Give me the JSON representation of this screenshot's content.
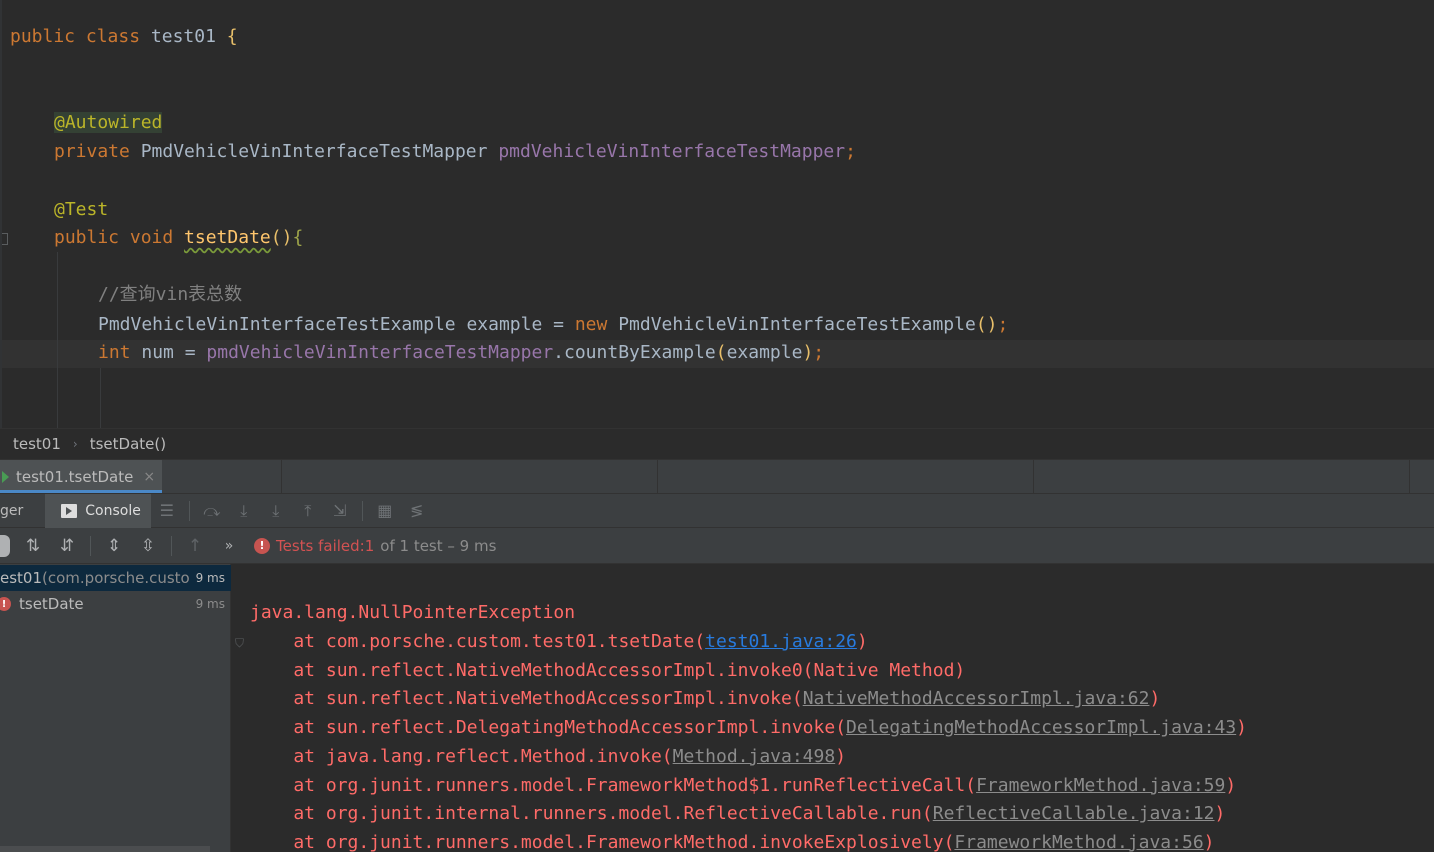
{
  "editor": {
    "lines": {
      "l1": {
        "kw": "public class ",
        "name": "test01 ",
        "brace": "{"
      },
      "l2": {
        "ann": "@Autowired"
      },
      "l3": {
        "kw": "private ",
        "type": "PmdVehicleVinInterfaceTestMapper ",
        "field": "pmdVehicleVinInterfaceTestMapper",
        "semi": ";"
      },
      "l4": {
        "ann": "@Test"
      },
      "l5": {
        "kw": "public void ",
        "fn": "tsetDate",
        "paren": "()",
        "brace": "{"
      },
      "l6": {
        "comment": "//查询vin表总数"
      },
      "l7": {
        "type": "PmdVehicleVinInterfaceTestExample example = ",
        "kw": "new ",
        "ctor": "PmdVehicleVinInterfaceTestExample",
        "paren": "()",
        "semi": ";"
      },
      "l8": {
        "kw": "int ",
        "var": "num = ",
        "field": "pmdVehicleVinInterfaceTestMapper",
        "call": ".countByExample",
        "arg_open": "(",
        "arg": "example",
        "arg_close": ")",
        "semi": ";"
      }
    }
  },
  "breadcrumb": {
    "class": "test01",
    "method": "tsetDate()"
  },
  "run_tab": {
    "label": "test01.tsetDate",
    "close": "×"
  },
  "toolbar": {
    "debugger_label": "ger",
    "console_label": "Console"
  },
  "test_status": {
    "prefix": "Tests failed: ",
    "failed": "1",
    "rest": "of 1 test – 9 ms"
  },
  "test_tree": {
    "root": {
      "name": "est01",
      "pkg": " (com.porsche.custo",
      "time": "9 ms"
    },
    "child": {
      "name": "tsetDate",
      "time": "9 ms"
    }
  },
  "console": {
    "exception": "java.lang.NullPointerException",
    "frames": [
      {
        "prefix": "    at com.porsche.custom.test01.tsetDate(",
        "link": "test01.java:26",
        "suffix": ")",
        "primary": true
      },
      {
        "prefix": "    at sun.reflect.NativeMethodAccessorImpl.invoke0(Native Method)",
        "link": "",
        "suffix": ""
      },
      {
        "prefix": "    at sun.reflect.NativeMethodAccessorImpl.invoke(",
        "link": "NativeMethodAccessorImpl.java:62",
        "suffix": ")"
      },
      {
        "prefix": "    at sun.reflect.DelegatingMethodAccessorImpl.invoke(",
        "link": "DelegatingMethodAccessorImpl.java:43",
        "suffix": ")"
      },
      {
        "prefix": "    at java.lang.reflect.Method.invoke(",
        "link": "Method.java:498",
        "suffix": ")"
      },
      {
        "prefix": "    at org.junit.runners.model.FrameworkMethod$1.runReflectiveCall(",
        "link": "FrameworkMethod.java:59",
        "suffix": ")"
      },
      {
        "prefix": "    at org.junit.internal.runners.model.ReflectiveCallable.run(",
        "link": "ReflectiveCallable.java:12",
        "suffix": ")"
      },
      {
        "prefix": "    at org.junit.runners.model.FrameworkMethod.invokeExplosively(",
        "link": "FrameworkMethod.java:56",
        "suffix": ")"
      }
    ]
  },
  "colors": {
    "editor_bg": "#2b2b2b",
    "panel_bg": "#3c3f41",
    "keyword": "#cc7832",
    "annotation": "#bbb529",
    "field": "#9876aa",
    "error_text": "#ff6b68",
    "link": "#287bde",
    "selection": "#0d293e"
  },
  "icons": [
    "play-icon",
    "console-icon",
    "error-icon",
    "sort-icon",
    "expand-icon",
    "collapse-icon",
    "up-arrow-icon",
    "chevrons-icon"
  ]
}
